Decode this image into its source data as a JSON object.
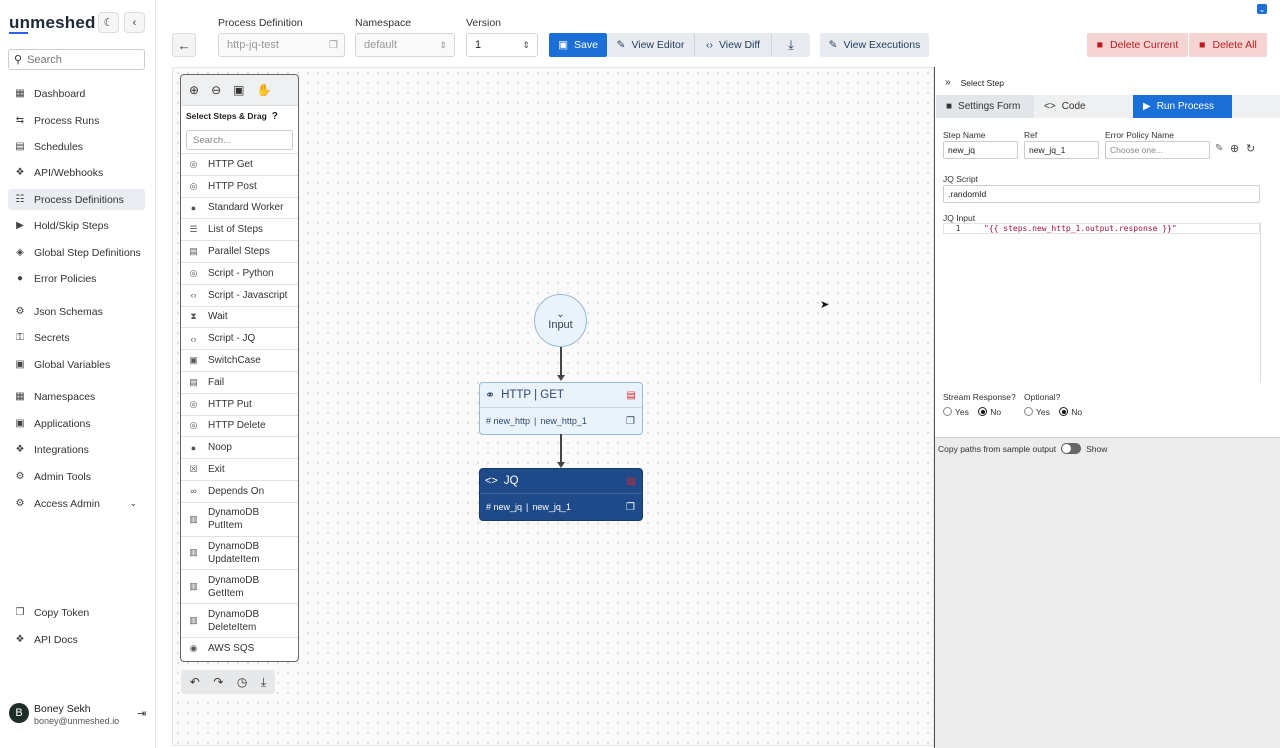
{
  "app": {
    "name": "unmeshed"
  },
  "sidebar": {
    "search_placeholder": "Search",
    "items": [
      {
        "label": "Dashboard",
        "icon": "dashboard-icon"
      },
      {
        "label": "Process Runs",
        "icon": "process-runs-icon"
      },
      {
        "label": "Schedules",
        "icon": "schedules-icon"
      },
      {
        "label": "API/Webhooks",
        "icon": "webhooks-icon"
      },
      {
        "label": "Process Definitions",
        "icon": "process-definitions-icon"
      },
      {
        "label": "Hold/Skip Steps",
        "icon": "hold-skip-icon"
      },
      {
        "label": "Global Step Definitions",
        "icon": "global-steps-icon"
      },
      {
        "label": "Error Policies",
        "icon": "error-policies-icon"
      },
      {
        "label": "Json Schemas",
        "icon": "json-schemas-icon"
      },
      {
        "label": "Secrets",
        "icon": "key-icon"
      },
      {
        "label": "Global Variables",
        "icon": "variables-icon"
      },
      {
        "label": "Namespaces",
        "icon": "namespaces-icon"
      },
      {
        "label": "Applications",
        "icon": "applications-icon"
      },
      {
        "label": "Integrations",
        "icon": "integrations-icon"
      },
      {
        "label": "Admin Tools",
        "icon": "gear-icon"
      },
      {
        "label": "Access Admin",
        "icon": "access-admin-icon"
      },
      {
        "label": "Copy Token",
        "icon": "copy-icon"
      },
      {
        "label": "API Docs",
        "icon": "api-docs-icon"
      }
    ],
    "user": {
      "initial": "B",
      "name": "Boney Sekh",
      "email": "boney@unmeshed.io"
    }
  },
  "toolbar": {
    "process_definition_label": "Process Definition",
    "process_definition_placeholder": "http-jq-test",
    "namespace_label": "Namespace",
    "namespace_value": "default",
    "version_label": "Version",
    "version_value": "1",
    "save_label": "Save",
    "view_editor_label": "View Editor",
    "view_diff_label": "View Diff",
    "view_executions_label": "View Executions",
    "delete_current_label": "Delete Current",
    "delete_all_label": "Delete All"
  },
  "palette": {
    "header": "Select Steps & Drag",
    "help": "?",
    "search_placeholder": "Search...",
    "items": [
      {
        "label": "HTTP Get",
        "icon": "http-icon"
      },
      {
        "label": "HTTP Post",
        "icon": "http-icon"
      },
      {
        "label": "Standard Worker",
        "icon": "worker-icon"
      },
      {
        "label": "List of Steps",
        "icon": "list-icon"
      },
      {
        "label": "Parallel Steps",
        "icon": "parallel-icon"
      },
      {
        "label": "Script - Python",
        "icon": "python-icon"
      },
      {
        "label": "Script - Javascript",
        "icon": "code-icon"
      },
      {
        "label": "Wait",
        "icon": "hourglass-icon"
      },
      {
        "label": "Script - JQ",
        "icon": "code-icon"
      },
      {
        "label": "SwitchCase",
        "icon": "switch-icon"
      },
      {
        "label": "Fail",
        "icon": "fail-icon"
      },
      {
        "label": "HTTP Put",
        "icon": "http-icon"
      },
      {
        "label": "HTTP Delete",
        "icon": "http-icon"
      },
      {
        "label": "Noop",
        "icon": "noop-icon"
      },
      {
        "label": "Exit",
        "icon": "exit-icon"
      },
      {
        "label": "Depends On",
        "icon": "link-icon"
      },
      {
        "label": "DynamoDB",
        "label2": "PutItem",
        "icon": "database-icon"
      },
      {
        "label": "DynamoDB",
        "label2": "UpdateItem",
        "icon": "database-icon"
      },
      {
        "label": "DynamoDB",
        "label2": "GetItem",
        "icon": "database-icon"
      },
      {
        "label": "DynamoDB",
        "label2": "DeleteItem",
        "icon": "database-icon"
      },
      {
        "label": "AWS SQS",
        "icon": "sqs-icon"
      }
    ]
  },
  "canvas": {
    "input_node": {
      "label": "Input"
    },
    "http_node": {
      "title": "HTTP | GET",
      "name": "# new_http",
      "ref": "new_http_1"
    },
    "jq_node": {
      "title": "JQ",
      "name": "# new_jq",
      "ref": "new_jq_1"
    }
  },
  "panel": {
    "header": "Select Step",
    "tabs": [
      {
        "label": "Settings Form"
      },
      {
        "label": "Code"
      },
      {
        "label": "Run Process"
      }
    ],
    "step_name_label": "Step Name",
    "step_name_value": "new_jq",
    "ref_label": "Ref",
    "ref_value": "new_jq_1",
    "error_policy_label": "Error Policy Name",
    "error_policy_placeholder": "Choose one...",
    "jq_script_label": "JQ Script",
    "jq_script_value": ".randomId",
    "jq_input_label": "JQ Input",
    "jq_input_line_number": "1",
    "jq_input_code": "\"{{ steps.new_http_1.output.response }}\"",
    "stream_response_label": "Stream Response?",
    "optional_label": "Optional?",
    "yes_label": "Yes",
    "no_label": "No",
    "stream_response_value": "No",
    "optional_value": "No",
    "copy_paths_label": "Copy paths from sample output",
    "show_label": "Show"
  }
}
